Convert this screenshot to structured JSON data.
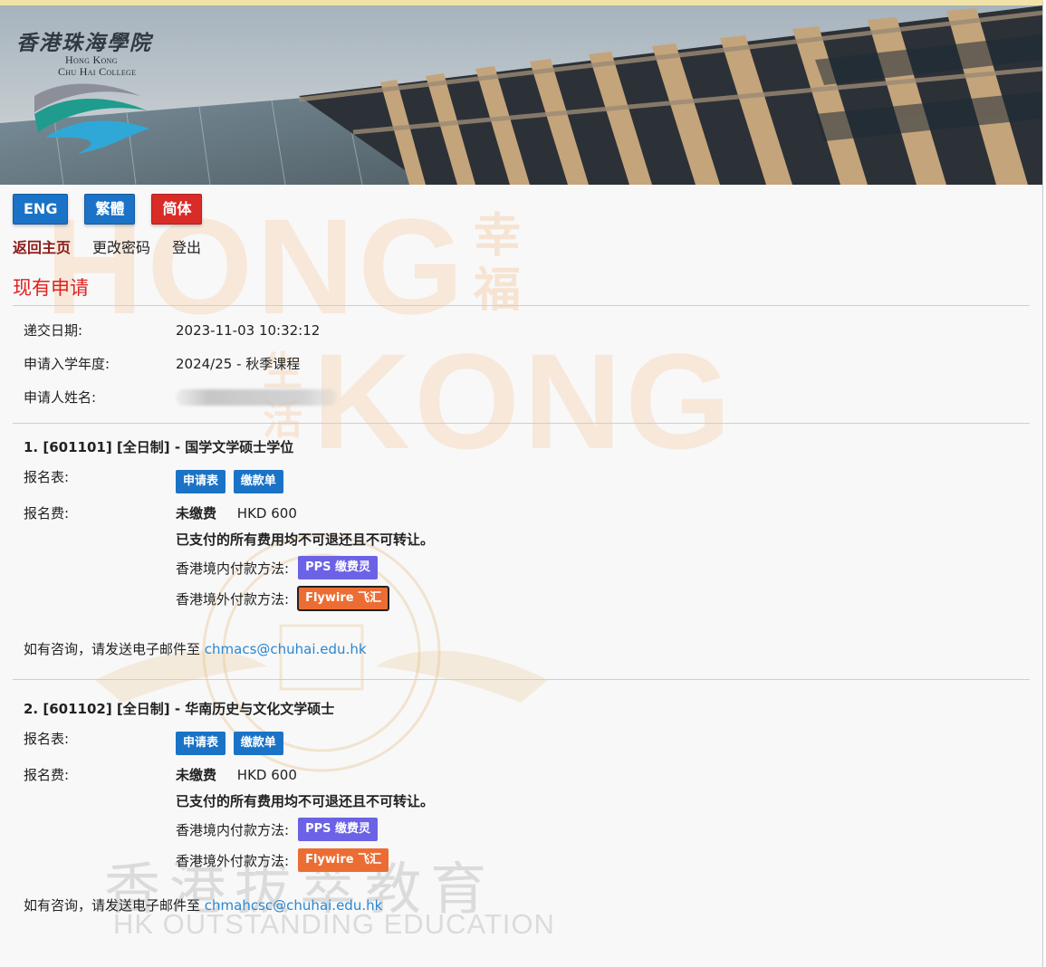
{
  "banner": {
    "logo_cn": "香港珠海學院",
    "logo_en_line1": "Hong Kong",
    "logo_en_line2": "Chu Hai College"
  },
  "lang_buttons": [
    {
      "label": "ENG",
      "color": "#1a73c6"
    },
    {
      "label": "繁體",
      "color": "#1a73c6"
    },
    {
      "label": "简体",
      "color": "#d92b28"
    }
  ],
  "nav": {
    "home": "返回主页",
    "change_password": "更改密码",
    "logout": "登出"
  },
  "section_title": "现有申请",
  "application": {
    "submit_date_label": "递交日期:",
    "submit_date": "2023-11-03 10:32:12",
    "year_label": "申请入学年度:",
    "year": "2024/25 - 秋季课程",
    "name_label": "申请人姓名:"
  },
  "programs": [
    {
      "title": "1. [601101] [全日制] - 国学文学硕士学位",
      "form_label": "报名表:",
      "form_btn": "申请表",
      "slip_btn": "缴款单",
      "fee_label": "报名费:",
      "fee_status": "未缴费",
      "fee_amount": "HKD 600",
      "notice": "已支付的所有费用均不可退还且不可转让。",
      "local_pay_label": "香港境内付款方法:",
      "local_pay_btn": "PPS 缴费灵",
      "overseas_pay_label": "香港境外付款方法:",
      "overseas_pay_btn": "Flywire 飞汇",
      "contact_text": "如有咨询，请发送电子邮件至",
      "contact_email": "chmacs@chuhai.edu.hk"
    },
    {
      "title": "2. [601102] [全日制] - 华南历史与文化文学硕士",
      "form_label": "报名表:",
      "form_btn": "申请表",
      "slip_btn": "缴款单",
      "fee_label": "报名费:",
      "fee_status": "未缴费",
      "fee_amount": "HKD 600",
      "notice": "已支付的所有费用均不可退还且不可转让。",
      "local_pay_label": "香港境内付款方法:",
      "local_pay_btn": "PPS 缴费灵",
      "overseas_pay_label": "香港境外付款方法:",
      "overseas_pay_btn": "Flywire 飞汇",
      "contact_text": "如有咨询，请发送电子邮件至",
      "contact_email": "chmahcsc@chuhai.edu.hk"
    }
  ],
  "watermark": {
    "hong": "HONG",
    "kong": "KONG",
    "xing_fu": "幸福",
    "sheng_huo": "生活",
    "cn": "香港拔萃教育",
    "en": "HK OUTSTANDING EDUCATION"
  }
}
